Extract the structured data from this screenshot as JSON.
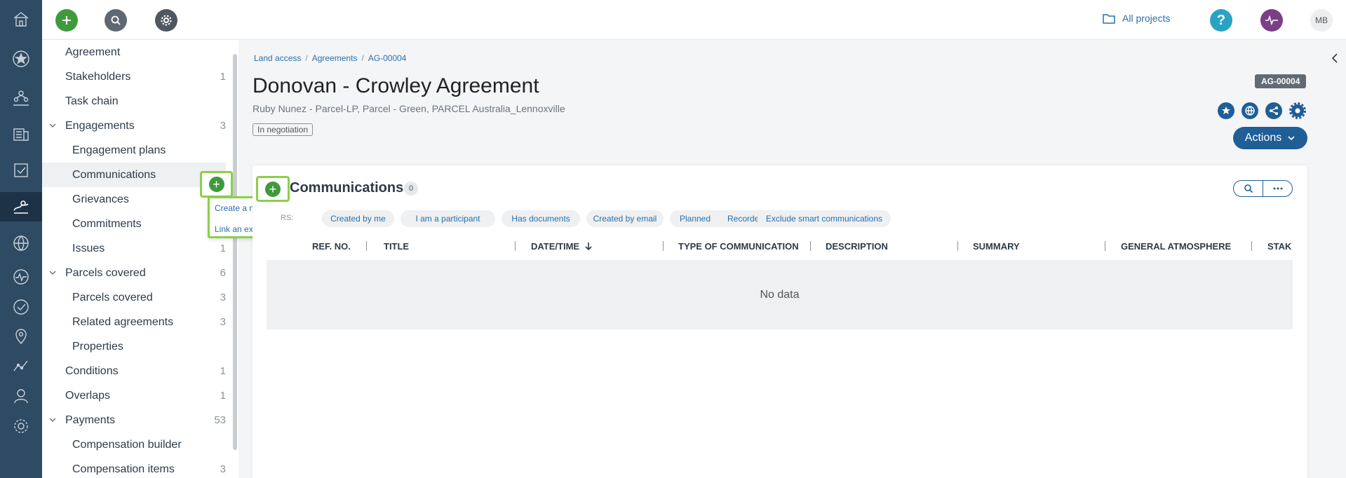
{
  "topbar": {
    "all_projects_label": "All projects",
    "user_initials": "MB"
  },
  "sidebar": {
    "items": [
      {
        "label": "Agreement",
        "count": ""
      },
      {
        "label": "Stakeholders",
        "count": "1"
      },
      {
        "label": "Task chain",
        "count": ""
      },
      {
        "label": "Engagements",
        "count": "3"
      },
      {
        "label": "Engagement plans",
        "count": ""
      },
      {
        "label": "Communications",
        "count": ""
      },
      {
        "label": "Grievances",
        "count": ""
      },
      {
        "label": "Commitments",
        "count": ""
      },
      {
        "label": "Issues",
        "count": "1"
      },
      {
        "label": "Parcels covered",
        "count": "6"
      },
      {
        "label": "Parcels covered",
        "count": "3"
      },
      {
        "label": "Related agreements",
        "count": "3"
      },
      {
        "label": "Properties",
        "count": ""
      },
      {
        "label": "Conditions",
        "count": "1"
      },
      {
        "label": "Overlaps",
        "count": "1"
      },
      {
        "label": "Payments",
        "count": "53"
      },
      {
        "label": "Compensation builder",
        "count": ""
      },
      {
        "label": "Compensation items",
        "count": "3"
      }
    ]
  },
  "add_menu": {
    "create_label": "Create a new record",
    "link_label": "Link an existing record"
  },
  "breadcrumb": {
    "items": [
      "Land access",
      "Agreements",
      "AG-00004"
    ]
  },
  "record": {
    "title": "Donovan - Crowley Agreement",
    "subtitle": "Ruby Nunez - Parcel-LP, Parcel - Green, PARCEL Australia_Lennoxville",
    "status": "In negotiation",
    "id_badge": "AG-00004",
    "actions_label": "Actions"
  },
  "communications": {
    "title": "Communications",
    "count": "0",
    "filters_label": "RS:",
    "filters": [
      "Created by me",
      "I am a participant",
      "Has documents",
      "Created by email",
      "Planned",
      "Recorded",
      "Exclude smart communications"
    ],
    "columns": [
      "REF. NO.",
      "TITLE",
      "DATE/TIME",
      "TYPE OF COMMUNICATION",
      "DESCRIPTION",
      "SUMMARY",
      "GENERAL ATMOSPHERE",
      "STAK"
    ],
    "empty_text": "No data"
  },
  "colors": {
    "rail": "#2f4a63",
    "accent_blue": "#1f5e96",
    "link_blue": "#2a6fa8",
    "green": "#3f9a3c",
    "highlight": "#8ccf4a"
  }
}
